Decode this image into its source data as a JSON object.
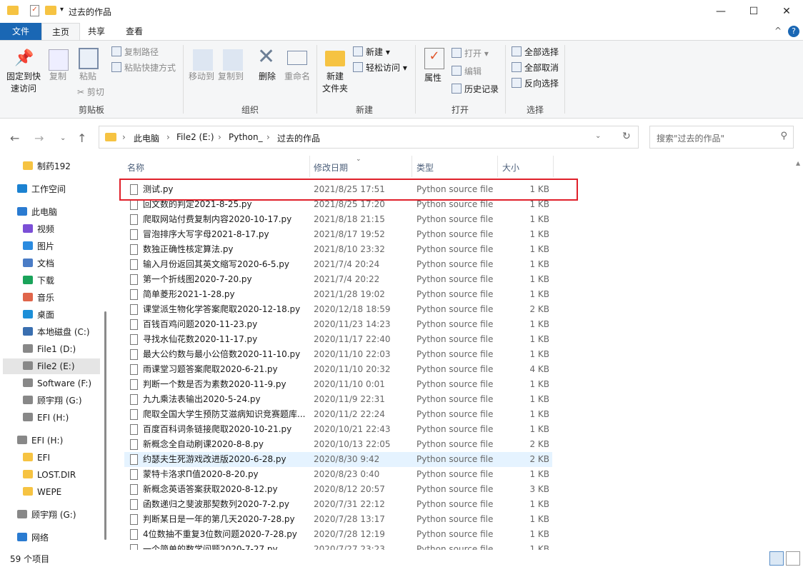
{
  "window": {
    "title": "过去的作品",
    "minimize": "—",
    "maximize": "☐",
    "close": "✕"
  },
  "tabs": [
    {
      "label": "文件"
    },
    {
      "label": "主页"
    },
    {
      "label": "共享"
    },
    {
      "label": "查看"
    }
  ],
  "ribbon": {
    "clipboard": {
      "group": "剪贴板",
      "pin": "固定到快速访问",
      "pin1": "固定到快",
      "pin2": "速访问",
      "copy": "复制",
      "paste": "粘贴",
      "copy_path": "复制路径",
      "paste_shortcut": "粘贴快捷方式",
      "cut": "剪切"
    },
    "organize": {
      "group": "组织",
      "move_to": "移动到",
      "copy_to": "复制到",
      "delete": "删除",
      "rename": "重命名"
    },
    "new": {
      "group": "新建",
      "new_folder1": "新建",
      "new_folder2": "文件夹",
      "new_item": "新建 ▾",
      "easy_access": "轻松访问 ▾"
    },
    "open": {
      "group": "打开",
      "properties": "属性",
      "open": "打开 ▾",
      "edit": "编辑",
      "history": "历史记录"
    },
    "select": {
      "group": "选择",
      "select_all": "全部选择",
      "select_none": "全部取消",
      "invert": "反向选择"
    },
    "help": "?",
    "collapse": "^"
  },
  "address": {
    "crumbs": [
      "此电脑",
      "File2 (E:)",
      "Python_",
      "过去的作品"
    ],
    "search_placeholder": "搜索\"过去的作品\""
  },
  "sidebar": {
    "items": [
      {
        "label": "制药192",
        "color": "#f6c342",
        "indent": 1
      },
      {
        "label": "工作空间",
        "color": "#1b82d1",
        "indent": 0
      },
      {
        "label": "此电脑",
        "color": "#2a7bd1",
        "indent": 0
      },
      {
        "label": "视频",
        "color": "#7b4fd6",
        "indent": 1
      },
      {
        "label": "图片",
        "color": "#2b8be0",
        "indent": 1
      },
      {
        "label": "文档",
        "color": "#4a7cc6",
        "indent": 1
      },
      {
        "label": "下载",
        "color": "#1aa35a",
        "indent": 1
      },
      {
        "label": "音乐",
        "color": "#e0654a",
        "indent": 1
      },
      {
        "label": "桌面",
        "color": "#1d8fd8",
        "indent": 1
      },
      {
        "label": "本地磁盘 (C:)",
        "color": "#3a6fb0",
        "indent": 1
      },
      {
        "label": "File1 (D:)",
        "color": "#888888",
        "indent": 1
      },
      {
        "label": "File2 (E:)",
        "color": "#888888",
        "indent": 1,
        "selected": true
      },
      {
        "label": "Software (F:)",
        "color": "#888888",
        "indent": 1
      },
      {
        "label": "顾宇翔 (G:)",
        "color": "#888888",
        "indent": 1
      },
      {
        "label": "EFI (H:)",
        "color": "#888888",
        "indent": 1
      },
      {
        "label": "EFI (H:)",
        "color": "#888888",
        "indent": 0
      },
      {
        "label": "EFI",
        "color": "#f6c342",
        "indent": 1
      },
      {
        "label": "LOST.DIR",
        "color": "#f6c342",
        "indent": 1
      },
      {
        "label": "WEPE",
        "color": "#f6c342",
        "indent": 1
      },
      {
        "label": "顾宇翔 (G:)",
        "color": "#888888",
        "indent": 0
      },
      {
        "label": "网络",
        "color": "#2a7bd1",
        "indent": 0
      }
    ]
  },
  "list": {
    "headers": {
      "name": "名称",
      "date": "修改日期",
      "type": "类型",
      "size": "大小"
    },
    "rows": [
      {
        "name": "测试.py",
        "date": "2021/8/25 17:51",
        "type": "Python source file",
        "size": "1 KB",
        "boxed": true
      },
      {
        "name": "回文数的判定2021-8-25.py",
        "date": "2021/8/25 17:20",
        "type": "Python source file",
        "size": "1 KB"
      },
      {
        "name": "爬取网站付费复制内容2020-10-17.py",
        "date": "2021/8/18 21:15",
        "type": "Python source file",
        "size": "1 KB"
      },
      {
        "name": "冒泡排序大写字母2021-8-17.py",
        "date": "2021/8/17 19:52",
        "type": "Python source file",
        "size": "1 KB"
      },
      {
        "name": "数独正确性核定算法.py",
        "date": "2021/8/10 23:32",
        "type": "Python source file",
        "size": "1 KB"
      },
      {
        "name": "输入月份返回其英文缩写2020-6-5.py",
        "date": "2021/7/4 20:24",
        "type": "Python source file",
        "size": "1 KB"
      },
      {
        "name": "第一个折线图2020-7-20.py",
        "date": "2021/7/4 20:22",
        "type": "Python source file",
        "size": "1 KB"
      },
      {
        "name": "简单菱形2021-1-28.py",
        "date": "2021/1/28 19:02",
        "type": "Python source file",
        "size": "1 KB"
      },
      {
        "name": "课堂派生物化学答案爬取2020-12-18.py",
        "date": "2020/12/18 18:59",
        "type": "Python source file",
        "size": "2 KB"
      },
      {
        "name": "百钱百鸡问题2020-11-23.py",
        "date": "2020/11/23 14:23",
        "type": "Python source file",
        "size": "1 KB"
      },
      {
        "name": "寻找水仙花数2020-11-17.py",
        "date": "2020/11/17 22:40",
        "type": "Python source file",
        "size": "1 KB"
      },
      {
        "name": "最大公约数与最小公倍数2020-11-10.py",
        "date": "2020/11/10 22:03",
        "type": "Python source file",
        "size": "1 KB"
      },
      {
        "name": "雨课堂习题答案爬取2020-6-21.py",
        "date": "2020/11/10 20:32",
        "type": "Python source file",
        "size": "4 KB"
      },
      {
        "name": "判断一个数是否为素数2020-11-9.py",
        "date": "2020/11/10 0:01",
        "type": "Python source file",
        "size": "1 KB"
      },
      {
        "name": "九九乘法表输出2020-5-24.py",
        "date": "2020/11/9 22:31",
        "type": "Python source file",
        "size": "1 KB"
      },
      {
        "name": "爬取全国大学生预防艾滋病知识竞赛题库...",
        "date": "2020/11/2 22:24",
        "type": "Python source file",
        "size": "1 KB"
      },
      {
        "name": "百度百科词条链接爬取2020-10-21.py",
        "date": "2020/10/21 22:43",
        "type": "Python source file",
        "size": "1 KB"
      },
      {
        "name": "新概念全自动刷课2020-8-8.py",
        "date": "2020/10/13 22:05",
        "type": "Python source file",
        "size": "2 KB"
      },
      {
        "name": "约瑟夫生死游戏改进版2020-6-28.py",
        "date": "2020/8/30 9:42",
        "type": "Python source file",
        "size": "2 KB",
        "hover": true
      },
      {
        "name": "蒙特卡洛求Π值2020-8-20.py",
        "date": "2020/8/23 0:40",
        "type": "Python source file",
        "size": "1 KB"
      },
      {
        "name": "新概念英语答案获取2020-8-12.py",
        "date": "2020/8/12 20:57",
        "type": "Python source file",
        "size": "3 KB"
      },
      {
        "name": "函数递归之斐波那契数列2020-7-2.py",
        "date": "2020/7/31 22:12",
        "type": "Python source file",
        "size": "1 KB"
      },
      {
        "name": "判断某日是一年的第几天2020-7-28.py",
        "date": "2020/7/28 13:17",
        "type": "Python source file",
        "size": "1 KB"
      },
      {
        "name": "4位数抽不重复3位数问题2020-7-28.py",
        "date": "2020/7/28 12:19",
        "type": "Python source file",
        "size": "1 KB"
      },
      {
        "name": "一个简单的数学问题2020-7-27.py",
        "date": "2020/7/27 23:23",
        "type": "Python source file",
        "size": "1 KB"
      }
    ]
  },
  "status": {
    "count": "59 个项目"
  },
  "colors": {
    "accent": "#1a67b4",
    "highlight_box": "#e0202a",
    "hover_row": "#e5f3ff"
  }
}
